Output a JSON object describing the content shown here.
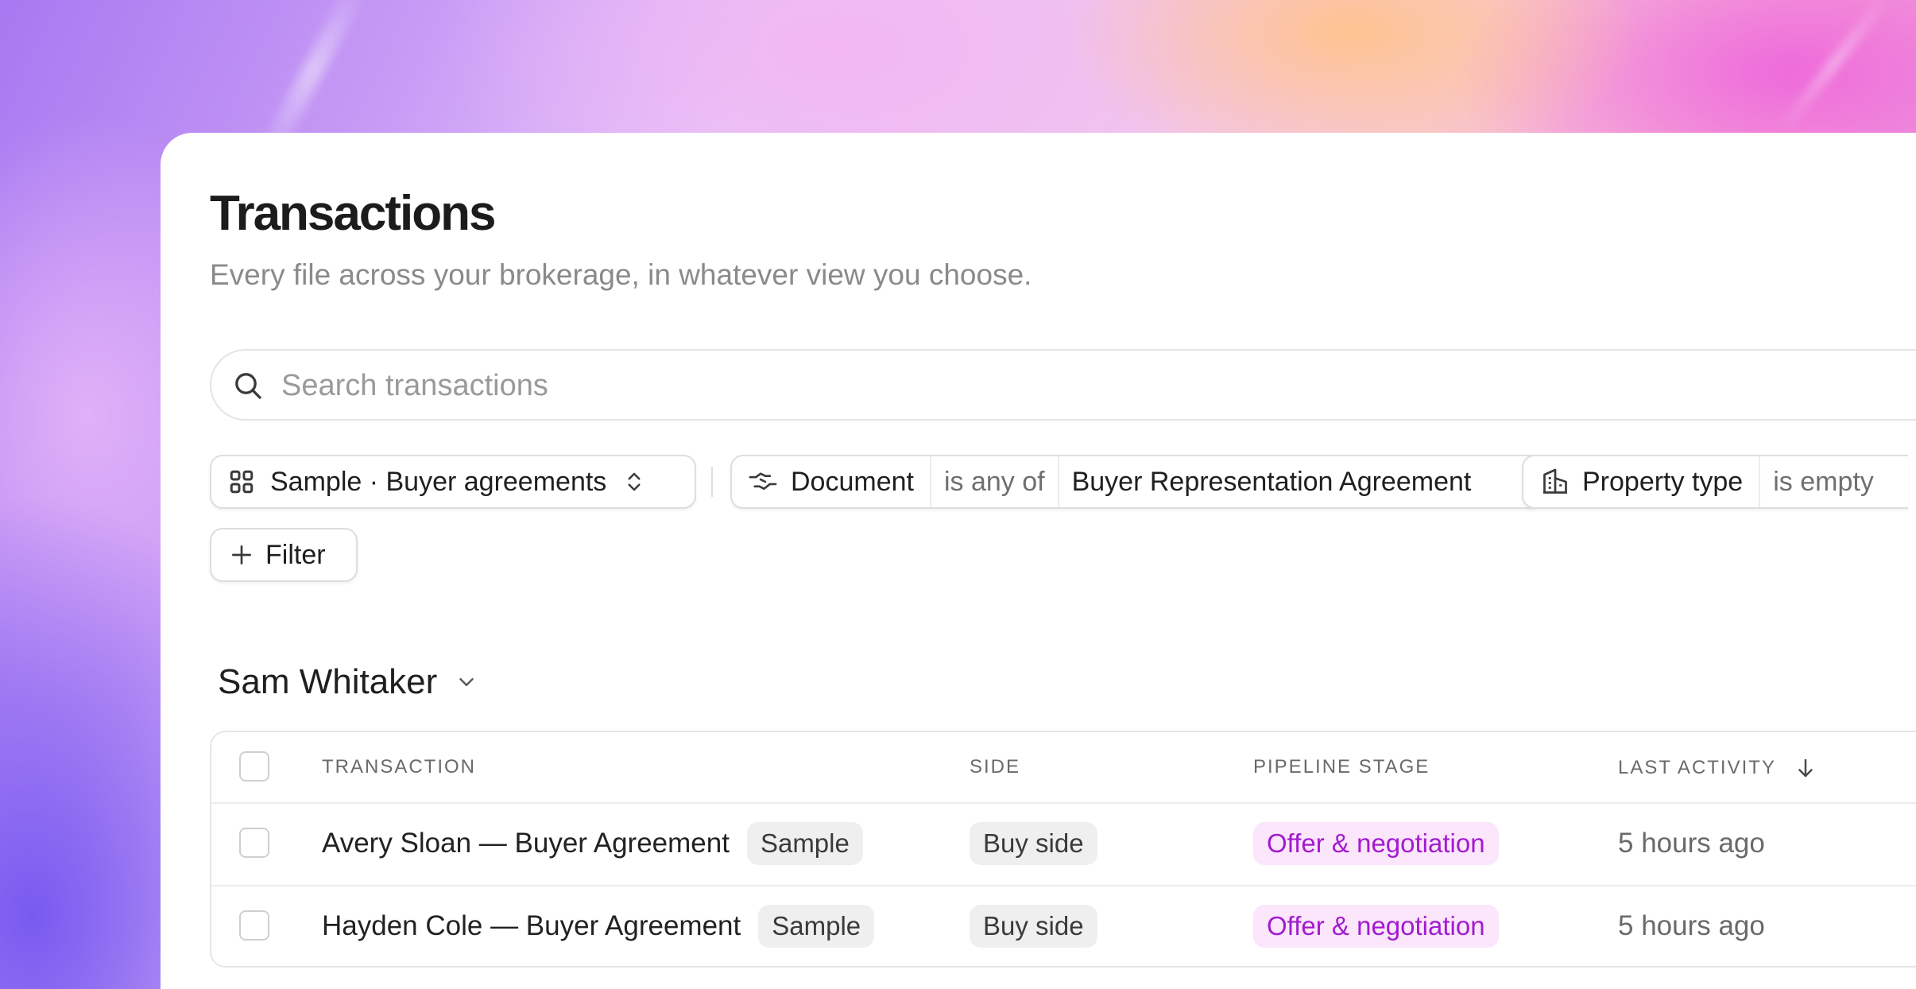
{
  "page": {
    "title": "Transactions",
    "subtitle": "Every file across your brokerage, in whatever view you choose."
  },
  "search": {
    "placeholder": "Search transactions"
  },
  "view_selector": {
    "label": "Sample · Buyer agreements"
  },
  "filters": [
    {
      "field": "Document",
      "operator": "is any of",
      "value": "Buyer Representation Agreement"
    },
    {
      "field": "Property type",
      "operator": "is empty"
    }
  ],
  "add_filter": {
    "label": "Filter"
  },
  "group": {
    "title": "Sam Whitaker"
  },
  "table": {
    "columns": [
      "TRANSACTION",
      "SIDE",
      "PIPELINE STAGE",
      "LAST ACTIVITY"
    ],
    "rows": [
      {
        "transaction": "Avery Sloan — Buyer Agreement",
        "tag": "Sample",
        "side": "Buy side",
        "stage": "Offer & negotiation",
        "last_activity": "5 hours ago"
      },
      {
        "transaction": "Hayden Cole — Buyer Agreement",
        "tag": "Sample",
        "side": "Buy side",
        "stage": "Offer & negotiation",
        "last_activity": "5 hours ago"
      }
    ]
  },
  "colors": {
    "stage_text": "#a21bcf",
    "stage_bg": "#fbe6fb",
    "tag_bg": "#efefef"
  },
  "icons": {
    "search": "search-icon",
    "view": "grid-icon",
    "view_toggle": "chevron-up-down-icon",
    "document": "handshake-icon",
    "property": "building-icon",
    "add": "plus-icon",
    "group_toggle": "chevron-down-icon",
    "sort": "arrow-down-icon"
  }
}
